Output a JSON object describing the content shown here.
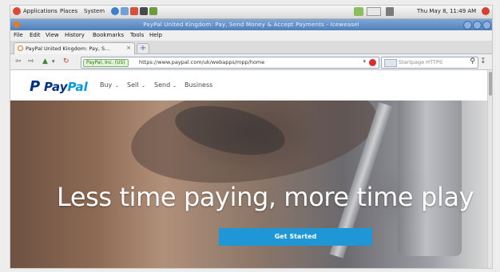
{
  "gnome_panel": {
    "menus": [
      "Applications",
      "Places",
      "System"
    ],
    "clock": "Thu May 8, 11:49 AM"
  },
  "window": {
    "title": "PayPal United Kingdom: Pay, Send Money & Accept Payments - Iceweasel"
  },
  "firefox_menu": [
    "File",
    "Edit",
    "View",
    "History",
    "Bookmarks",
    "Tools",
    "Help"
  ],
  "tabs": [
    {
      "label": "PayPal United Kingdom: Pay, S...",
      "close": "×"
    }
  ],
  "new_tab_label": "+",
  "navbar": {
    "identity": "PayPal, Inc. (US)",
    "url": "https://www.paypal.com/uk/webapps/mpp/home",
    "dropdown": "▾",
    "search_placeholder": "Startpage HTTPS"
  },
  "paypal": {
    "logo_mark": "P",
    "logo_word_1": "Pay",
    "logo_word_2": "Pal",
    "nav": [
      "Buy",
      "Sell",
      "Send",
      "Business"
    ],
    "hero_title": "Less time paying, more time play",
    "cta_label": "Get Started"
  },
  "colors": {
    "paypal_dark_blue": "#003087",
    "paypal_light_blue": "#009cde",
    "cta_blue": "#1f97d7",
    "titlebar_blue": "#4f7fba"
  }
}
